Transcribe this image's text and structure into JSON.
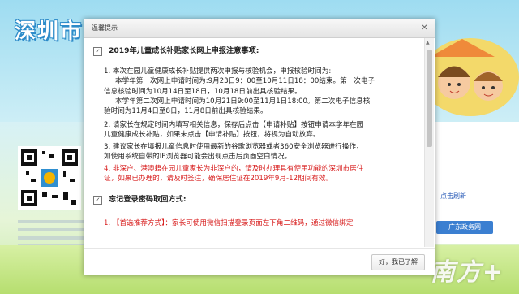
{
  "background": {
    "site_title": "深圳市",
    "refresh_link": "点击刷新",
    "gd_button": "广东政务网",
    "watermark": "南方+"
  },
  "dialog": {
    "title": "温馨提示",
    "close_icon": "close-icon",
    "section1": {
      "heading": "2019年儿童成长补贴家长网上申报注意事项:",
      "item1_line1": "1. 本次在园儿童健康成长补贴提供两次申报与核验机会，申报核验时间为:",
      "item1_line2": "本学年第一次网上申请时间为:9月23日9：00至10月11日18：00结束。第一次电子",
      "item1_line3": "信息核验时间为10月14日至18日，10月18日前出具核验结果。",
      "item1_line4": "本学年第二次网上申请时间为10月21日9:00至11月1日18:00。第二次电子信息核",
      "item1_line5": "验时间为11月4日至8日，11月8日前出具核验结果。",
      "item2_line1": "2. 请家长在规定时间内填写相关信息，保存后点击【申请补贴】按钮申请本学年在园",
      "item2_line2": "儿童健康成长补贴，如果未点击【申请补贴】按钮，将视为自动放弃。",
      "item3_line1": "3. 建议家长在填报儿童信息时使用最新的谷歌浏览器或者360安全浏览器进行操作，",
      "item3_line2": "如使用系统自带的IE浏览器可能会出现点击后页面空白情况。",
      "item4_line1": "4. 非深户、港澳籍在园儿童家长为非深户的，请及时办理具有使用功能的深圳市居住",
      "item4_line2": "证，如果已办理的，请及时签注，确保居住证在2019年9月-12期间有效。"
    },
    "section2": {
      "heading": "忘记登录密码取回方式:",
      "item1_partial": "1. 【首选推荐方式】：家长可使用微信扫描登录页面左下角二维码，通过微信绑定"
    },
    "ok_button": "好，我已了解"
  },
  "colors": {
    "red_text": "#d81e1e",
    "title_blue": "#2d8bc9"
  }
}
